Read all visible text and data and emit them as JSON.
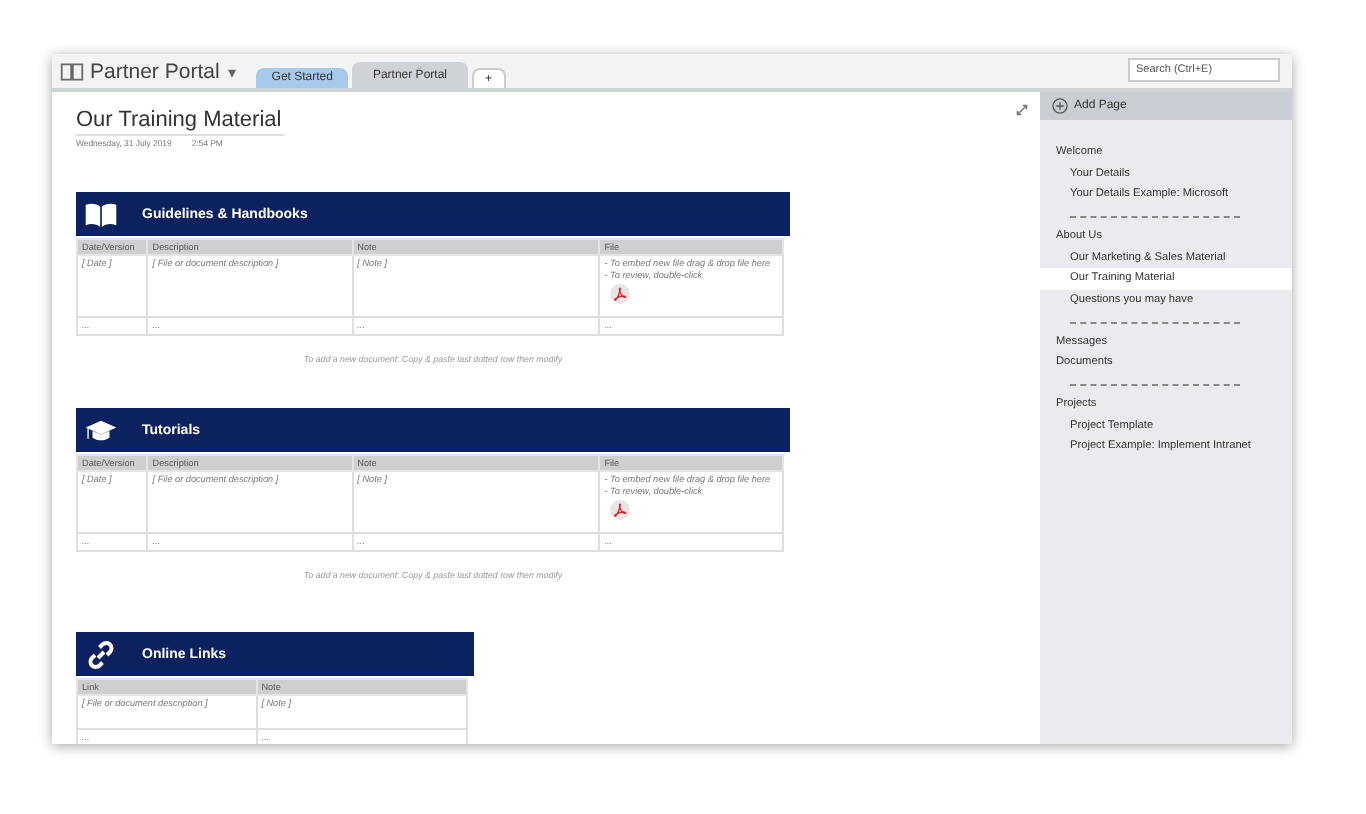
{
  "notebook": {
    "title": "Partner Portal",
    "caret": "▾"
  },
  "tabs": [
    {
      "label": "Get Started",
      "selected": false,
      "color": "#a9c9ea"
    },
    {
      "label": "Partner Portal",
      "selected": true,
      "color": "#cfd3d8"
    },
    {
      "label": "+",
      "selected": false,
      "color": "#ffffff"
    }
  ],
  "search": {
    "placeholder": "Search (Ctrl+E)"
  },
  "page": {
    "title": "Our Training Material",
    "date": "Wednesday, 31 July 2019",
    "time": "2:54 PM"
  },
  "sections": [
    {
      "title": "Guidelines & Handbooks",
      "columns": [
        "Date/Version",
        "Description",
        "Note",
        "File"
      ],
      "rows": [
        {
          "cells": [
            {
              "lines": [
                "[ Date ]"
              ]
            },
            {
              "lines": [
                "[ File or document description ]"
              ]
            },
            {
              "lines": [
                "[ Note ]"
              ]
            },
            {
              "lines": [
                "- To embed new file drag & drop file here",
                "- To review, double-click"
              ],
              "pdf_icon": true
            }
          ]
        },
        {
          "cells": [
            {
              "lines": [
                "..."
              ]
            },
            {
              "lines": [
                "..."
              ]
            },
            {
              "lines": [
                "..."
              ]
            },
            {
              "lines": [
                "..."
              ]
            }
          ]
        }
      ],
      "note": "To add a new document: Copy & paste last dotted row then modify"
    },
    {
      "title": "Tutorials",
      "columns": [
        "Date/Version",
        "Description",
        "Note",
        "File"
      ],
      "rows": [
        {
          "cells": [
            {
              "lines": [
                "[ Date ]"
              ]
            },
            {
              "lines": [
                "[ File or document description ]"
              ]
            },
            {
              "lines": [
                "[ Note ]"
              ]
            },
            {
              "lines": [
                "- To embed new file drag & drop file here",
                "- To review, double-click"
              ],
              "pdf_icon": true
            }
          ]
        },
        {
          "cells": [
            {
              "lines": [
                "..."
              ]
            },
            {
              "lines": [
                "..."
              ]
            },
            {
              "lines": [
                "..."
              ]
            },
            {
              "lines": [
                "..."
              ]
            }
          ]
        }
      ],
      "note": "To add a new document: Copy & paste last dotted row then modify"
    },
    {
      "title": "Online Links",
      "columns": [
        "Link",
        "Note"
      ],
      "rows": [
        {
          "cells": [
            {
              "lines": [
                "[ File or document description ]"
              ]
            },
            {
              "lines": [
                "[ Note ]"
              ]
            }
          ]
        },
        {
          "cells": [
            {
              "lines": [
                "..."
              ]
            },
            {
              "lines": [
                "..."
              ]
            }
          ]
        }
      ]
    }
  ],
  "sidebar": {
    "add_page": "Add Page",
    "items": [
      {
        "kind": "page",
        "label": "Welcome",
        "selected": false,
        "children": [
          {
            "kind": "page",
            "label": "Your Details",
            "selected": false
          },
          {
            "kind": "page",
            "label": "Your Details Example: Microsoft",
            "selected": false
          }
        ]
      },
      {
        "kind": "separator"
      },
      {
        "kind": "page",
        "label": "About Us",
        "selected": false,
        "children": [
          {
            "kind": "page",
            "label": "Our Marketing & Sales Material",
            "selected": false
          },
          {
            "kind": "page",
            "label": "Our Training Material",
            "selected": true
          },
          {
            "kind": "page",
            "label": "Questions you may have",
            "selected": false
          }
        ]
      },
      {
        "kind": "separator"
      },
      {
        "kind": "page",
        "label": "Messages",
        "selected": false
      },
      {
        "kind": "page",
        "label": "Documents",
        "selected": false
      },
      {
        "kind": "separator"
      },
      {
        "kind": "page",
        "label": "Projects",
        "selected": false,
        "children": [
          {
            "kind": "page",
            "label": "Project Template",
            "selected": false
          },
          {
            "kind": "page",
            "label": "Project Example: Implement Intranet",
            "selected": false
          }
        ]
      }
    ]
  }
}
